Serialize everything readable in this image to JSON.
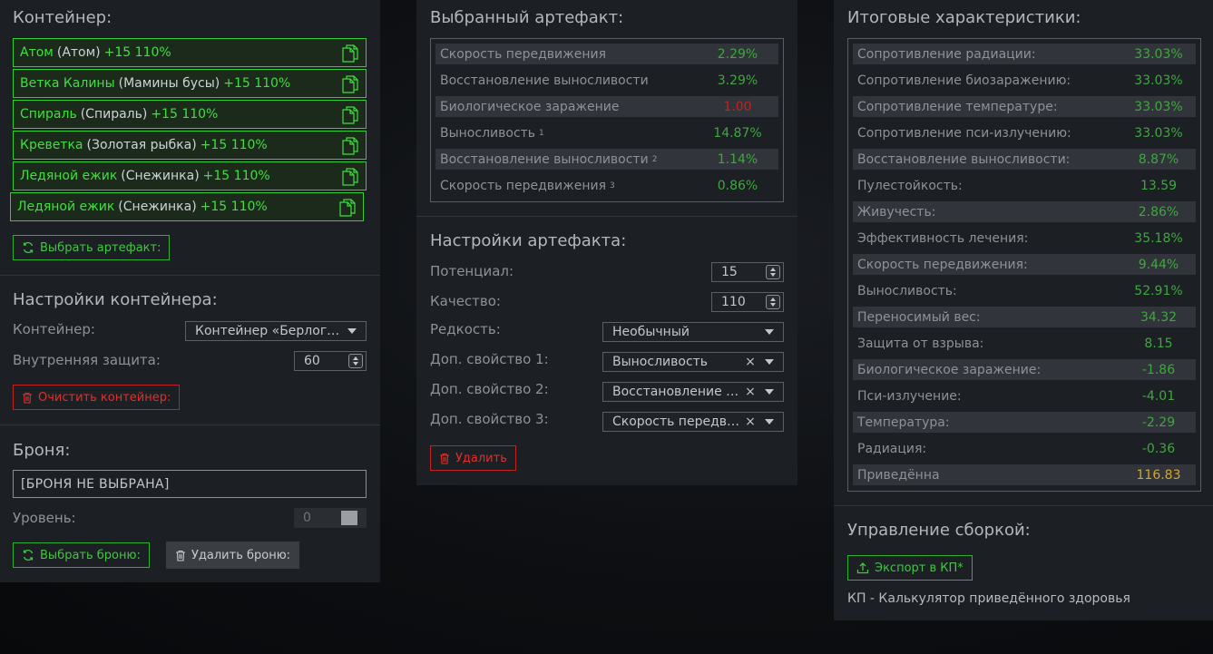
{
  "left": {
    "container_title": "Контейнер:",
    "items": [
      {
        "name": "Атом",
        "paren": "(Атом)",
        "bonus": "+15 110%"
      },
      {
        "name": "Ветка Калины",
        "paren": "(Мамины бусы)",
        "bonus": "+15 110%"
      },
      {
        "name": "Спираль",
        "paren": "(Спираль)",
        "bonus": "+15 110%"
      },
      {
        "name": "Креветка",
        "paren": "(Золотая рыбка)",
        "bonus": "+15 110%"
      },
      {
        "name": "Ледяной ежик",
        "paren": "(Снежинка)",
        "bonus": "+15 110%"
      },
      {
        "name": "Ледяной ежик",
        "paren": "(Снежинка)",
        "bonus": "+15 110%"
      }
    ],
    "select_artifact_btn": "Выбрать артефакт:",
    "container_settings_title": "Настройки контейнера:",
    "container_label": "Контейнер:",
    "container_value": "Контейнер «Берлога...",
    "inner_protection_label": "Внутренняя защита:",
    "inner_protection_value": "60",
    "clear_container_btn": "Очистить контейнер:",
    "armor_title": "Броня:",
    "armor_value": "[БРОНЯ НЕ ВЫБРАНА]",
    "level_label": "Уровень:",
    "level_value": "0",
    "select_armor_btn": "Выбрать броню:",
    "delete_armor_btn": "Удалить броню:"
  },
  "middle": {
    "selected_title": "Выбранный артефакт:",
    "stats": [
      {
        "label": "Скорость передвижения",
        "sup": "",
        "value": "2.29%",
        "color": "#3ea83e"
      },
      {
        "label": "Восстановление выносливости",
        "sup": "",
        "value": "3.29%",
        "color": "#3ea83e"
      },
      {
        "label": "Биологическое заражение",
        "sup": "",
        "value": "1.00",
        "color": "#c0221f"
      },
      {
        "label": "Выносливость",
        "sup": "1",
        "value": "14.87%",
        "color": "#3ea83e"
      },
      {
        "label": "Восстановление выносливости",
        "sup": "2",
        "value": "1.14%",
        "color": "#3ea83e"
      },
      {
        "label": "Скорость передвижения",
        "sup": "3",
        "value": "0.86%",
        "color": "#3ea83e"
      }
    ],
    "settings_title": "Настройки артефакта:",
    "potential_label": "Потенциал:",
    "potential_value": "15",
    "quality_label": "Качество:",
    "quality_value": "110",
    "rarity_label": "Редкость:",
    "rarity_value": "Необычный",
    "prop1_label": "Доп. свойство 1:",
    "prop1_value": "Выносливость",
    "prop2_label": "Доп. свойство 2:",
    "prop2_value": "Восстановление в...",
    "prop3_label": "Доп. свойство 3:",
    "prop3_value": "Скорость передви...",
    "clear_x": "×",
    "delete_btn": "Удалить"
  },
  "right": {
    "totals_title": "Итоговые характеристики:",
    "stats": [
      {
        "label": "Сопротивление радиации:",
        "value": "33.03%",
        "color": "#3ea83e"
      },
      {
        "label": "Сопротивление биозаражению:",
        "value": "33.03%",
        "color": "#3ea83e"
      },
      {
        "label": "Сопротивление температуре:",
        "value": "33.03%",
        "color": "#3ea83e"
      },
      {
        "label": "Сопротивление пси-излучению:",
        "value": "33.03%",
        "color": "#3ea83e"
      },
      {
        "label": "Восстановление выносливости:",
        "value": "8.87%",
        "color": "#3ea83e"
      },
      {
        "label": "Пулестойкость:",
        "value": "13.59",
        "color": "#3ea83e"
      },
      {
        "label": "Живучесть:",
        "value": "2.86%",
        "color": "#3ea83e"
      },
      {
        "label": "Эффективность лечения:",
        "value": "35.18%",
        "color": "#3ea83e"
      },
      {
        "label": "Скорость передвижения:",
        "value": "9.44%",
        "color": "#3ea83e"
      },
      {
        "label": "Выносливость:",
        "value": "52.91%",
        "color": "#3ea83e"
      },
      {
        "label": "Переносимый вес:",
        "value": "34.32",
        "color": "#3ea83e"
      },
      {
        "label": "Защита от взрыва:",
        "value": "8.15",
        "color": "#3ea83e"
      },
      {
        "label": "Биологическое заражение:",
        "value": "-1.86",
        "color": "#3ea83e"
      },
      {
        "label": "Пси-излучение:",
        "value": "-4.01",
        "color": "#3ea83e"
      },
      {
        "label": "Температура:",
        "value": "-2.29",
        "color": "#3ea83e"
      },
      {
        "label": "Радиация:",
        "value": "-0.36",
        "color": "#3ea83e"
      },
      {
        "label": "Приведённа",
        "value": "116.83",
        "color": "#d4a62a"
      }
    ],
    "build_title": "Управление сборкой:",
    "export_btn": "Экспорт в КП*",
    "footnote": "КП - Калькулятор приведённого здоровья"
  }
}
